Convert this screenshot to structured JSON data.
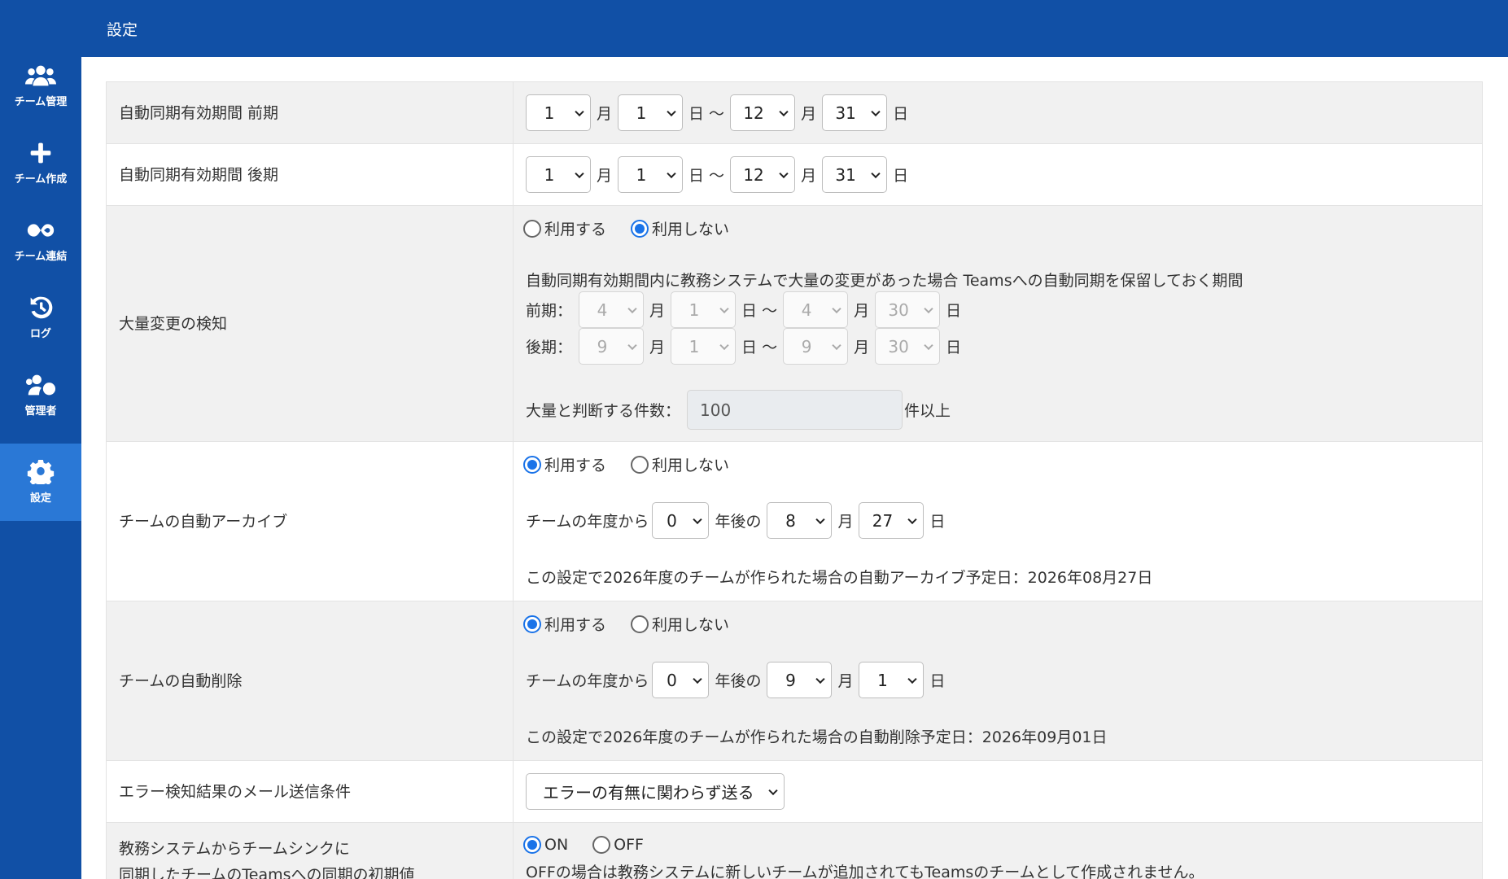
{
  "page": {
    "title": "設定"
  },
  "sidebar": {
    "items": [
      {
        "label": "チーム管理",
        "icon": "users-icon"
      },
      {
        "label": "チーム作成",
        "icon": "plus-icon"
      },
      {
        "label": "チーム連結",
        "icon": "infinity-icon"
      },
      {
        "label": "ログ",
        "icon": "history-icon"
      },
      {
        "label": "管理者",
        "icon": "users-cog-icon"
      },
      {
        "label": "設定",
        "icon": "gear-icon",
        "active": true
      }
    ]
  },
  "units": {
    "month": "月",
    "day": "日",
    "tilde": "日 〜"
  },
  "sync_first": {
    "label": "自動同期有効期間 前期",
    "start_month": "1",
    "start_day": "1",
    "end_month": "12",
    "end_day": "31"
  },
  "sync_second": {
    "label": "自動同期有効期間 後期",
    "start_month": "1",
    "start_day": "1",
    "end_month": "12",
    "end_day": "31"
  },
  "mass_change": {
    "label": "大量変更の検知",
    "use_label": "利用する",
    "nouse_label": "利用しない",
    "selected": "nouse",
    "description": "自動同期有効期間内に教務システムで大量の変更があった場合 Teamsへの自動同期を保留しておく期間",
    "first_label": "前期：",
    "first": {
      "start_month": "4",
      "start_day": "1",
      "end_month": "4",
      "end_day": "30"
    },
    "second_label": "後期：",
    "second": {
      "start_month": "9",
      "start_day": "1",
      "end_month": "9",
      "end_day": "30"
    },
    "count_label": "大量と判断する件数：",
    "count_value": "100",
    "count_suffix": "件以上"
  },
  "auto_archive": {
    "label": "チームの自動アーカイブ",
    "use_label": "利用する",
    "nouse_label": "利用しない",
    "selected": "use",
    "prefix": "チームの年度から",
    "years": "0",
    "years_suffix": "年後の",
    "month": "8",
    "day": "27",
    "note": "この設定で2026年度のチームが作られた場合の自動アーカイブ予定日：2026年08月27日"
  },
  "auto_delete": {
    "label": "チームの自動削除",
    "use_label": "利用する",
    "nouse_label": "利用しない",
    "selected": "use",
    "prefix": "チームの年度から",
    "years": "0",
    "years_suffix": "年後の",
    "month": "9",
    "day": "1",
    "note": "この設定で2026年度のチームが作られた場合の自動削除予定日：2026年09月01日"
  },
  "mail_condition": {
    "label": "エラー検知結果のメール送信条件",
    "value": "エラーの有無に関わらず送る"
  },
  "initial_sync": {
    "label_line1": "教務システムからチームシンクに",
    "label_line2": "同期したチームのTeamsへの同期の初期値",
    "on_label": "ON",
    "off_label": "OFF",
    "selected": "on",
    "note": "OFFの場合は教務システムに新しいチームが追加されてもTeamsのチームとして作成されません。"
  }
}
